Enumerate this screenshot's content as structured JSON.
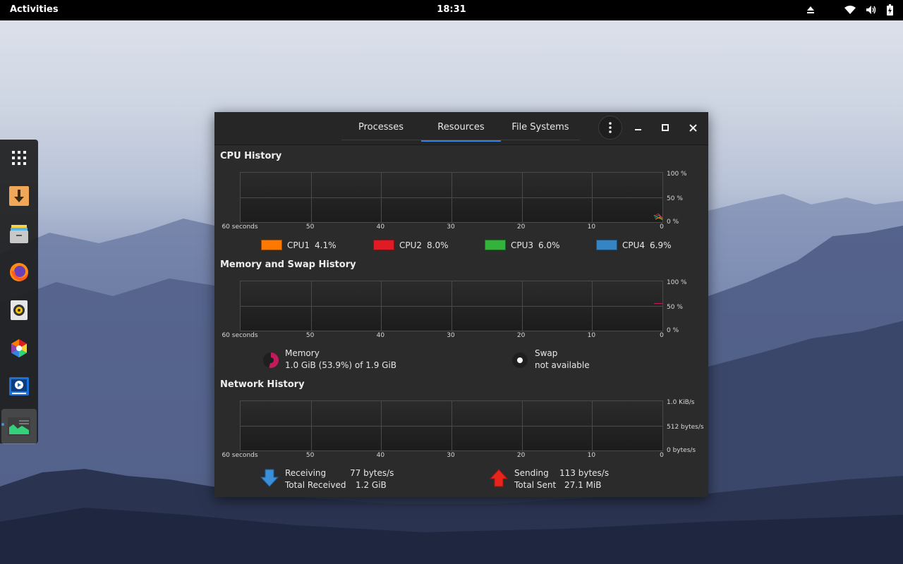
{
  "topbar": {
    "activities": "Activities",
    "clock": "18:31",
    "tray_icons": [
      "eject-icon",
      "wifi-icon",
      "volume-icon",
      "battery-icon"
    ]
  },
  "dock": {
    "items": [
      "app-grid-icon",
      "downloader-icon",
      "files-icon",
      "firefox-icon",
      "rhythmbox-icon",
      "color-picker-icon",
      "video-player-icon",
      "system-monitor-icon"
    ]
  },
  "window": {
    "tabs": [
      "Processes",
      "Resources",
      "File Systems"
    ],
    "selected_tab": "Resources",
    "controls": [
      "menu-icon",
      "minimize-icon",
      "maximize-icon",
      "close-icon"
    ],
    "x_ticks": [
      "60 seconds",
      "50",
      "40",
      "30",
      "20",
      "10",
      "0"
    ],
    "cpu": {
      "title": "CPU History",
      "y_ticks": [
        "100 %",
        "50 %",
        "0 %"
      ],
      "cores": [
        {
          "name": "CPU1",
          "value": "4.1%",
          "color": "#ff7800"
        },
        {
          "name": "CPU2",
          "value": "8.0%",
          "color": "#e01b24"
        },
        {
          "name": "CPU3",
          "value": "6.0%",
          "color": "#33b33b"
        },
        {
          "name": "CPU4",
          "value": "6.9%",
          "color": "#3584c4"
        }
      ]
    },
    "memory": {
      "title": "Memory and Swap History",
      "y_ticks": [
        "100 %",
        "50 %",
        "0 %"
      ],
      "mem_label": "Memory",
      "mem_value": "1.0 GiB (53.9%) of 1.9 GiB",
      "mem_fraction": 0.539,
      "mem_color": "#c01c5c",
      "swap_label": "Swap",
      "swap_value": "not available"
    },
    "network": {
      "title": "Network History",
      "y_ticks": [
        "1.0 KiB/s",
        "512 bytes/s",
        "0 bytes/s"
      ],
      "receiving_label": "Receiving",
      "receiving_value": "77 bytes/s",
      "total_received_label": "Total Received",
      "total_received_value": "1.2 GiB",
      "sending_label": "Sending",
      "sending_value": "113 bytes/s",
      "total_sent_label": "Total Sent",
      "total_sent_value": "27.1 MiB",
      "receive_color": "#3a8fd6",
      "send_color": "#e8251c"
    }
  }
}
